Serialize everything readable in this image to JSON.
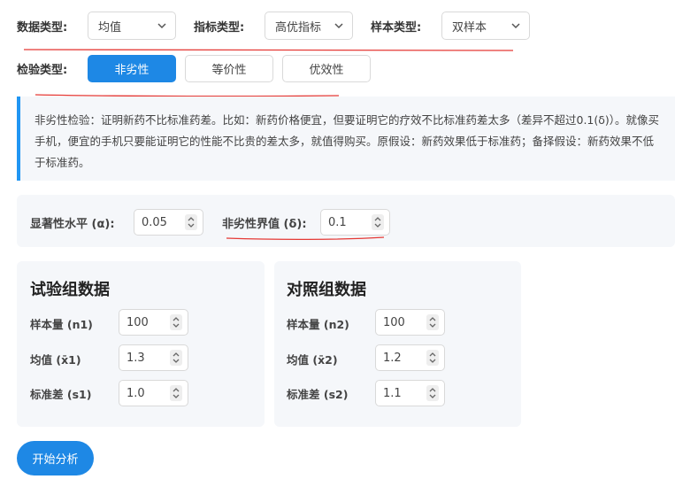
{
  "selectors": {
    "data_type": {
      "label": "数据类型:",
      "value": "均值"
    },
    "indicator_type": {
      "label": "指标类型:",
      "value": "高优指标"
    },
    "sample_type": {
      "label": "样本类型:",
      "value": "双样本"
    }
  },
  "test_type": {
    "label": "检验类型:",
    "options": [
      "非劣性",
      "等价性",
      "优效性"
    ],
    "selected": "非劣性"
  },
  "info_text": "非劣性检验：证明新药不比标准药差。比如：新药价格便宜，但要证明它的疗效不比标准药差太多（差异不超过0.1(δ)）。就像买手机，便宜的手机只要能证明它的性能不比贵的差太多，就值得购买。原假设：新药效果低于标准药；备择假设：新药效果不低于标准药。",
  "params": {
    "alpha": {
      "label": "显著性水平 (α):",
      "value": "0.05"
    },
    "delta": {
      "label": "非劣性界值 (δ):",
      "value": "0.1"
    }
  },
  "groups": {
    "test": {
      "title": "试验组数据",
      "fields": [
        {
          "label": "样本量 (n1)",
          "value": "100"
        },
        {
          "label": "均值 (x̄1)",
          "value": "1.3"
        },
        {
          "label": "标准差 (s1)",
          "value": "1.0"
        }
      ]
    },
    "control": {
      "title": "对照组数据",
      "fields": [
        {
          "label": "样本量 (n2)",
          "value": "100"
        },
        {
          "label": "均值 (x̄2)",
          "value": "1.2"
        },
        {
          "label": "标准差 (s2)",
          "value": "1.1"
        }
      ]
    }
  },
  "start_button": "开始分析",
  "colors": {
    "primary": "#1e88e5",
    "panel_bg": "#f5f7fa",
    "annotation_red": "#e53935",
    "info_border": "#2196f3"
  }
}
